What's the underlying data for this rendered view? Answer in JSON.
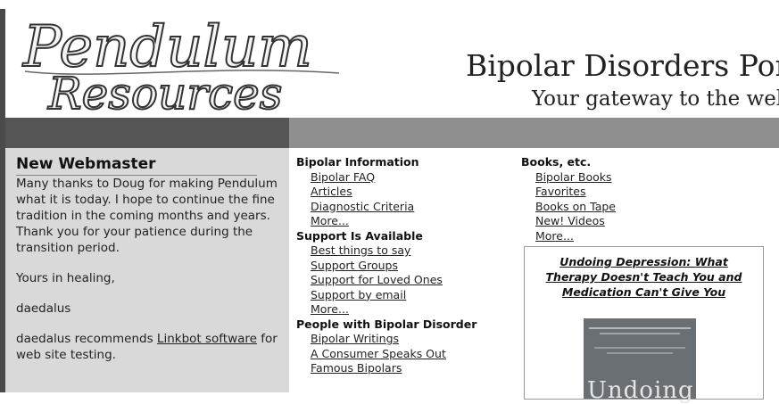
{
  "header": {
    "logo_top": "Pendulum",
    "logo_bottom": "Resources",
    "title": "Bipolar Disorders Port",
    "tagline": "Your gateway to the web"
  },
  "sidebar": {
    "heading": "New Webmaster",
    "para1": "Many thanks to Doug for making Pendulum what it is today. I hope to continue the fine tradition in the coming months and years.",
    "para2": "Thank you for your patience during the transition period.",
    "signoff": "Yours in healing,",
    "signature": "daedalus",
    "recommend_prefix": "daedalus recommends ",
    "recommend_link": "Linkbot software",
    "recommend_suffix": " for web site testing."
  },
  "col1": {
    "sections": [
      {
        "heading": "Bipolar Information",
        "links": [
          "Bipolar FAQ",
          "Articles",
          "Diagnostic Criteria",
          "More..."
        ]
      },
      {
        "heading": "Support Is Available",
        "links": [
          "Best things to say",
          "Support Groups",
          "Support for Loved Ones",
          "Support by email",
          "More..."
        ]
      },
      {
        "heading": "People with Bipolar Disorder",
        "links": [
          "Bipolar Writings",
          "A Consumer Speaks Out",
          "Famous Bipolars"
        ]
      }
    ]
  },
  "col2": {
    "heading": "Books, etc.",
    "links": [
      "Bipolar Books",
      "Favorites",
      "Books on Tape",
      "New! Videos",
      "More..."
    ],
    "featured_title": "Undoing Depression: What Therapy Doesn't Teach You and Medication Can't Give You",
    "cover_word": "Undoing"
  },
  "colors": {
    "band_dark": "#555555",
    "band_light": "#8f8f8f",
    "sidebar_bg": "#d9d9d9"
  }
}
